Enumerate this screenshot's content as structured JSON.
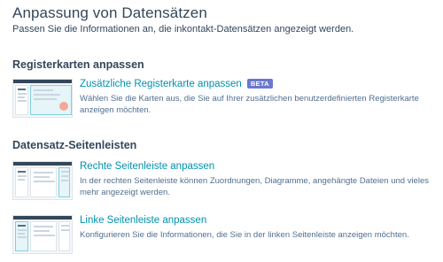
{
  "header": {
    "title": "Anpassung von Datensätzen",
    "subtitle": "Passen Sie die Informationen an, die inkontakt-Datensätzen angezeigt werden."
  },
  "sections": [
    {
      "title": "Registerkarten anpassen",
      "cards": [
        {
          "title": "Zusätzliche Registerkarte anpassen",
          "badge": "BETA",
          "description": "Wählen Sie die Karten aus, die Sie auf Ihrer zusätzlichen benutzerdefinierten Registerkarte anzeigen möchten."
        }
      ]
    },
    {
      "title": "Datensatz-Seitenleisten",
      "cards": [
        {
          "title": "Rechte Seitenleiste anpassen",
          "description": "In der rechten Seitenleiste können Zuordnungen, Diagramme, angehängte Dateien und vieles mehr angezeigt werden."
        },
        {
          "title": "Linke Seitenleiste anpassen",
          "description": "Konfigurieren Sie die Informationen, die Sie in der linken Seitenleiste anzeigen möchten."
        }
      ]
    }
  ],
  "colors": {
    "text": "#33475b",
    "link": "#0091ae",
    "badge": "#6a78d1",
    "highlight": "#7fd1de"
  }
}
